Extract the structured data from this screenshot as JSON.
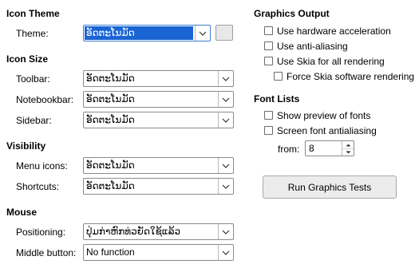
{
  "icon_theme": {
    "heading": "Icon Theme",
    "theme_label": "Theme:",
    "theme_value": "ອັດຕະໂນມັດ"
  },
  "icon_size": {
    "heading": "Icon Size",
    "toolbar_label": "Toolbar:",
    "toolbar_value": "ອັດຕະໂນມັດ",
    "notebookbar_label": "Notebookbar:",
    "notebookbar_value": "ອັດຕະໂນມັດ",
    "sidebar_label": "Sidebar:",
    "sidebar_value": "ອັດຕະໂນມັດ"
  },
  "visibility": {
    "heading": "Visibility",
    "menu_icons_label": "Menu icons:",
    "menu_icons_value": "ອັດຕະໂນມັດ",
    "shortcuts_label": "Shortcuts:",
    "shortcuts_value": "ອັດຕະໂນມັດ"
  },
  "mouse": {
    "heading": "Mouse",
    "positioning_label": "Positioning:",
    "positioning_value": "ປຸ່ມກ່າຫົກທ່ວຍັດໃຊ້ແລ້ວ",
    "middle_button_label": "Middle button:",
    "middle_button_value": "No function"
  },
  "graphics_output": {
    "heading": "Graphics Output",
    "hw_accel": "Use hardware acceleration",
    "anti_aliasing": "Use anti-aliasing",
    "skia_all": "Use Skia for all rendering",
    "skia_force": "Force Skia software rendering"
  },
  "font_lists": {
    "heading": "Font Lists",
    "show_preview": "Show preview of fonts",
    "screen_aa": "Screen font antialiasing",
    "from_label": "from:",
    "from_value": "8"
  },
  "run_tests_button": "Run Graphics Tests"
}
